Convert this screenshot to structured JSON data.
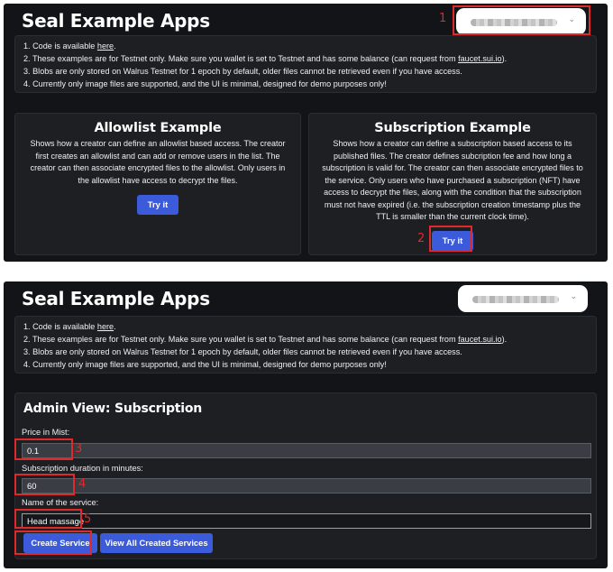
{
  "app_title": "Seal Example Apps",
  "info_lines": [
    {
      "prefix": "1. Code is available ",
      "link": "here",
      "suffix": "."
    },
    {
      "prefix": "2. These examples are for Testnet only. Make sure you wallet is set to Testnet and has some balance (can request from ",
      "link": "faucet.sui.io",
      "suffix": ")."
    },
    {
      "prefix": "3. Blobs are only stored on Walrus Testnet for 1 epoch by default, older files cannot be retrieved even if you have access.",
      "link": "",
      "suffix": ""
    },
    {
      "prefix": "4. Currently only image files are supported, and the UI is minimal, designed for demo purposes only!",
      "link": "",
      "suffix": ""
    }
  ],
  "allowlist_card": {
    "title": "Allowlist Example",
    "desc_lines": [
      "Shows how a creator can define an allowlist based access. The creator",
      "first creates an allowlist and can add or remove users in the list. The",
      "creator can then associate encrypted files to the allowlist. Only users in",
      "the allowlist have access to decrypt the files."
    ],
    "button": "Try it"
  },
  "subscription_card": {
    "title": "Subscription Example",
    "desc_lines": [
      "Shows how a creator can define a subscription based access to its",
      "published files. The creator defines subcription fee and how long a",
      "subscription is valid for. The creator can then associate encrypted files to",
      "the service. Only users who have purchased a subscription (NFT) have",
      "access to decrypt the files, along with the condition that the subscription",
      "must not have expired (i.e. the subscription creation timestamp plus the",
      "TTL is smaller than the current clock time)."
    ],
    "button": "Try it"
  },
  "admin": {
    "title": "Admin View: Subscription",
    "price_label": "Price in Mist:",
    "price_value": "0.1",
    "duration_label": "Subscription duration in minutes:",
    "duration_value": "60",
    "name_label": "Name of the service:",
    "name_value": "Head massage",
    "create_button": "Create Service",
    "view_button": "View All Created Services"
  },
  "annotations": [
    "1",
    "2",
    "3",
    "4",
    "5"
  ],
  "colors": {
    "panel_bg": "#121417",
    "card_bg": "#1d1f23",
    "button_blue": "#3b5bdb",
    "annotation_red": "#e0292b"
  }
}
